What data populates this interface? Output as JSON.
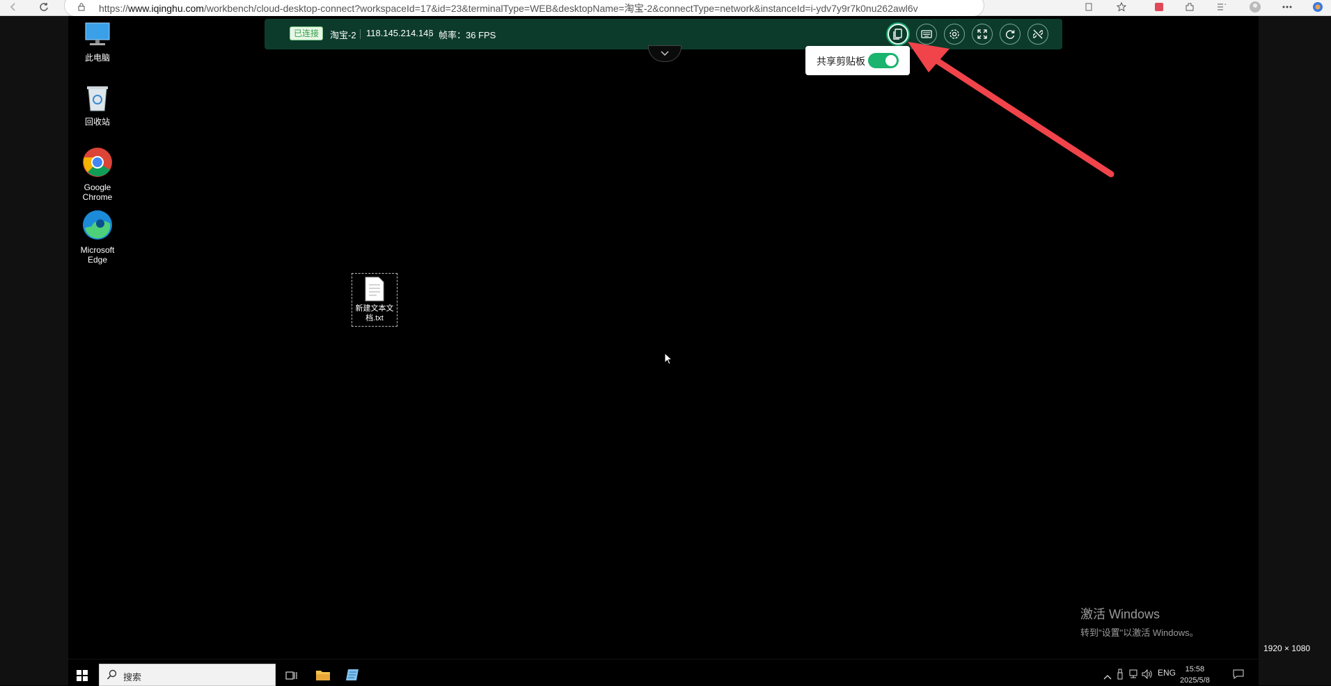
{
  "browser": {
    "url_prefix": "https://",
    "url_host": "www.iqinghu.com",
    "url_rest": "/workbench/cloud-desktop-connect?workspaceId=17&id=23&terminalType=WEB&desktopName=淘宝-2&connectType=network&instanceId=i-ydv7y9r7k0nu262awl6v"
  },
  "toolbar": {
    "status_badge": "已连接",
    "desktop_name": "淘宝-2",
    "ip_address": "118.145.214.146",
    "fps_label": "帧率：36 FPS",
    "buttons": [
      "clipboard-icon",
      "keyboard-icon",
      "gear-icon",
      "fullscreen-icon",
      "refresh-icon",
      "disconnect-icon"
    ]
  },
  "clipboard_popover": {
    "label": "共享剪贴板",
    "toggle_on": true
  },
  "desktop": {
    "icons": [
      {
        "label": "此电脑",
        "icon": "computer-icon"
      },
      {
        "label": "回收站",
        "icon": "recycle-bin-icon"
      },
      {
        "label": "Google Chrome",
        "icon": "chrome-icon"
      },
      {
        "label": "Microsoft Edge",
        "icon": "edge-icon"
      }
    ],
    "file_label": "新建文本文档.txt"
  },
  "watermark": {
    "line1": "激活 Windows",
    "line2": "转到\"设置\"以激活 Windows。"
  },
  "resolution_label": "1920 × 1080",
  "taskbar": {
    "search_placeholder": "搜索",
    "language": "ENG",
    "time": "15:58",
    "date": "2025/5/8"
  },
  "colors": {
    "toolbar_bg": "#0c3b2c",
    "accent_green": "#1ab46e",
    "arrow_red": "#f0444a"
  }
}
